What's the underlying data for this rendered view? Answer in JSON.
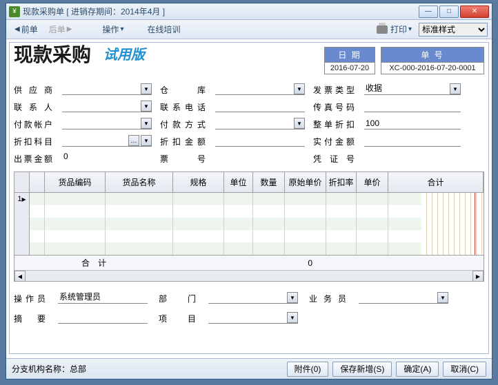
{
  "window": {
    "title": "现款采购单 [ 进销存期间：2014年4月 ]"
  },
  "toolbar": {
    "prev": "前单",
    "next": "后单",
    "operate": "操作",
    "training": "在线培训",
    "print": "打印",
    "style_label": "标准样式"
  },
  "header": {
    "title": "现款采购",
    "trial": "试用版",
    "date_label": "日 期",
    "date_value": "2016-07-20",
    "no_label": "单 号",
    "no_value": "XC-000-2016-07-20-0001"
  },
  "form": {
    "supplier_label": "供 应 商",
    "warehouse_label": "仓　库",
    "invoice_type_label": "发票类型",
    "invoice_type_value": "收据",
    "contact_label": "联 系 人",
    "phone_label": "联系电话",
    "fax_label": "传真号码",
    "pay_account_label": "付款帐户",
    "pay_method_label": "付款方式",
    "order_discount_label": "整单折扣",
    "order_discount_value": "100",
    "discount_subject_label": "折扣科目",
    "discount_amount_label": "折扣金额",
    "actual_pay_label": "实付金额",
    "draft_amount_label": "出票金额",
    "draft_amount_value": "0",
    "draft_no_label": "票　号",
    "voucher_no_label": "凭 证 号"
  },
  "table": {
    "cols": [
      "货品编码",
      "货品名称",
      "规格",
      "单位",
      "数量",
      "原始单价",
      "折扣率",
      "单价",
      "合计"
    ],
    "total_label": "合　计",
    "total_qty": "0"
  },
  "form2": {
    "operator_label": "操作员",
    "operator_value": "系统管理员",
    "dept_label": "部　门",
    "sales_label": "业务员",
    "summary_label": "摘　要",
    "project_label": "项　目"
  },
  "status": {
    "branch": "分支机构名称：总部",
    "attach": "附件(0)",
    "save_new": "保存新增(S)",
    "ok": "确定(A)",
    "cancel": "取消(C)"
  }
}
